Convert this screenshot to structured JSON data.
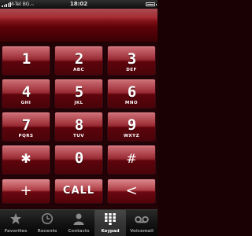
{
  "status_bar": {
    "carrier": "M-Tel BG",
    "time": "18:02"
  },
  "display": {
    "number": ""
  },
  "keypad": {
    "keys": [
      {
        "digit": "1",
        "letters": ""
      },
      {
        "digit": "2",
        "letters": "ABC"
      },
      {
        "digit": "3",
        "letters": "DEF"
      },
      {
        "digit": "4",
        "letters": "GHI"
      },
      {
        "digit": "5",
        "letters": "JKL"
      },
      {
        "digit": "6",
        "letters": "MNO"
      },
      {
        "digit": "7",
        "letters": "PQRS"
      },
      {
        "digit": "8",
        "letters": "TUV"
      },
      {
        "digit": "9",
        "letters": "WXYZ"
      },
      {
        "digit": "✱",
        "letters": ""
      },
      {
        "digit": "0",
        "letters": ""
      },
      {
        "digit": "#",
        "letters": ""
      }
    ],
    "add_contact_glyph": "+",
    "call_label": "CALL",
    "backspace_glyph": "<"
  },
  "tab_bar": {
    "tabs": [
      {
        "label": "Favorites",
        "icon": "star-icon",
        "active": false
      },
      {
        "label": "Recents",
        "icon": "clock-icon",
        "active": false
      },
      {
        "label": "Contacts",
        "icon": "person-icon",
        "active": false
      },
      {
        "label": "Keypad",
        "icon": "keypad-grid-icon",
        "active": true
      },
      {
        "label": "Voicemail",
        "icon": "voicemail-icon",
        "active": false
      }
    ]
  },
  "colors": {
    "key_red": "#8e111b",
    "background": "#230306",
    "tab_bar": "#141414"
  }
}
